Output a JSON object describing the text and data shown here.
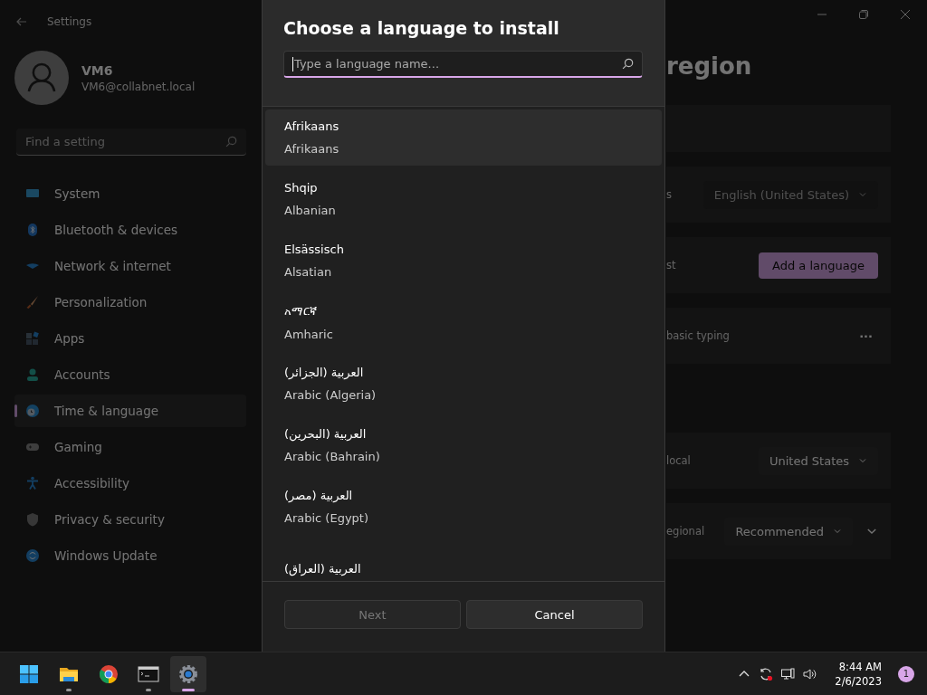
{
  "window": {
    "title": "Settings"
  },
  "account": {
    "name": "VM6",
    "email": "VM6@collabnet.local"
  },
  "search": {
    "placeholder": "Find a setting"
  },
  "nav": [
    {
      "label": "System",
      "kind": "system",
      "selected": false
    },
    {
      "label": "Bluetooth & devices",
      "kind": "bluetooth",
      "selected": false
    },
    {
      "label": "Network & internet",
      "kind": "network",
      "selected": false
    },
    {
      "label": "Personalization",
      "kind": "brush",
      "selected": false
    },
    {
      "label": "Apps",
      "kind": "apps",
      "selected": false
    },
    {
      "label": "Accounts",
      "kind": "person",
      "selected": false
    },
    {
      "label": "Time & language",
      "kind": "clock",
      "selected": true
    },
    {
      "label": "Gaming",
      "kind": "gamepad",
      "selected": false
    },
    {
      "label": "Accessibility",
      "kind": "accessibility",
      "selected": false
    },
    {
      "label": "Privacy & security",
      "kind": "shield",
      "selected": false
    },
    {
      "label": "Windows Update",
      "kind": "update",
      "selected": false
    }
  ],
  "page": {
    "heading": "region",
    "rows": [
      {
        "kind": "blank"
      },
      {
        "kind": "dropdown",
        "label": "s",
        "value": "English (United States)",
        "disabled": true
      },
      {
        "kind": "button",
        "label": "st",
        "value": "Add a language"
      },
      {
        "kind": "more",
        "label": "basic typing",
        "value": "···"
      },
      {
        "kind": "gap"
      },
      {
        "kind": "dropdown",
        "label": "local",
        "value": "United States",
        "disabled": false
      },
      {
        "kind": "dropdown-expand",
        "label": "egional",
        "value": "Recommended",
        "disabled": false
      }
    ]
  },
  "dialog": {
    "title": "Choose a language to install",
    "search_placeholder": "Type a language name...",
    "languages": [
      {
        "native": "Afrikaans",
        "english": "Afrikaans",
        "highlighted": true
      },
      {
        "native": "Shqip",
        "english": "Albanian",
        "highlighted": false
      },
      {
        "native": "Elsässisch",
        "english": "Alsatian",
        "highlighted": false
      },
      {
        "native": "አማርኛ",
        "english": "Amharic",
        "highlighted": false
      },
      {
        "native": "العربية (الجزائر)",
        "english": "Arabic (Algeria)",
        "highlighted": false
      },
      {
        "native": "العربية (البحرين)",
        "english": "Arabic (Bahrain)",
        "highlighted": false
      },
      {
        "native": "العربية (مصر)",
        "english": "Arabic (Egypt)",
        "highlighted": false
      },
      {
        "native": "العربية (العراق)",
        "highlighted": false
      }
    ],
    "buttons": [
      {
        "label": "Next",
        "disabled": true
      },
      {
        "label": "Cancel",
        "disabled": false
      }
    ]
  },
  "taskbar": {
    "apps": [
      {
        "kind": "start",
        "running": false,
        "active": false
      },
      {
        "kind": "folder",
        "running": true,
        "active": false
      },
      {
        "kind": "browser",
        "running": false,
        "active": false
      },
      {
        "kind": "terminal",
        "running": true,
        "active": false
      },
      {
        "kind": "settings",
        "running": true,
        "active": true
      }
    ],
    "time": "8:44 AM",
    "date": "2/6/2023",
    "notifications": "1"
  }
}
